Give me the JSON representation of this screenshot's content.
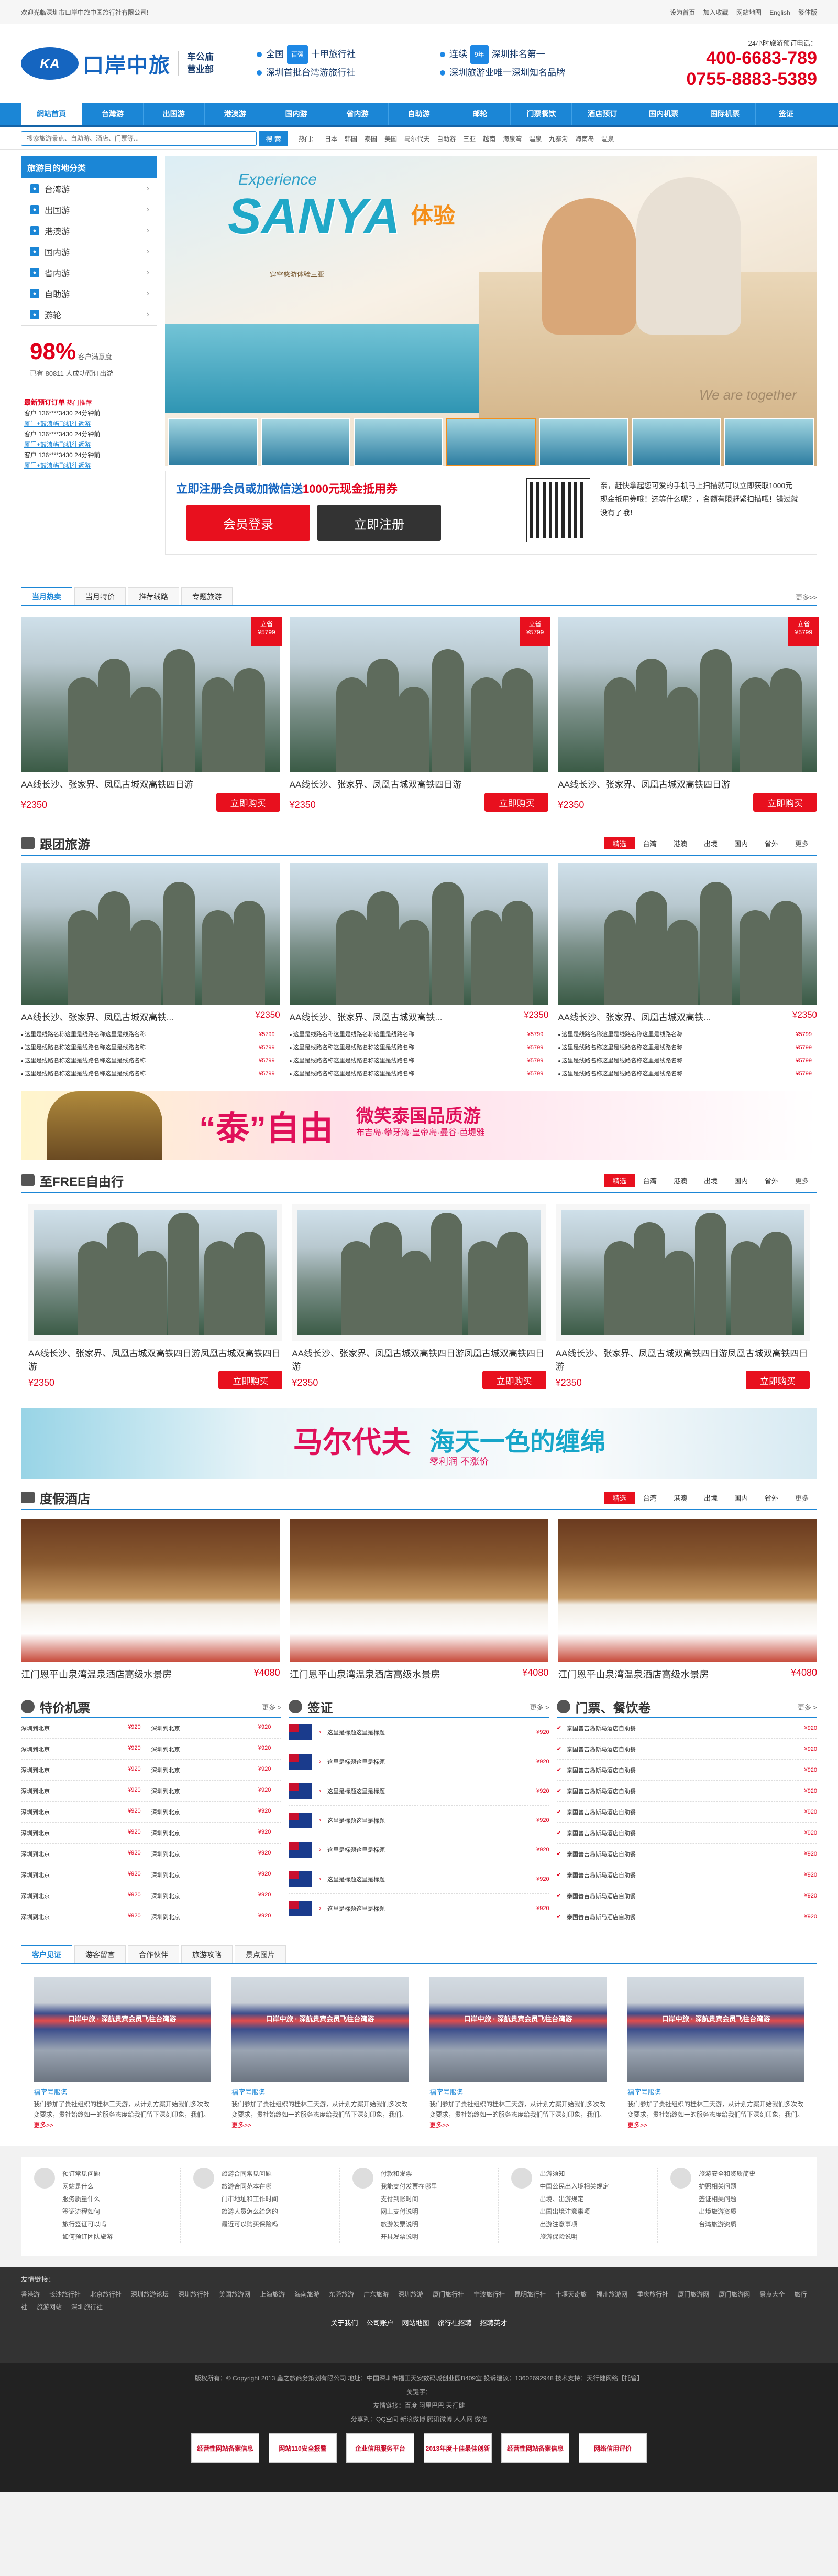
{
  "topbar": {
    "welcome": "欢迎光临深圳市口岸中旅中国旅行社有限公司!",
    "links": [
      "设为首页",
      "加入收藏",
      "网站地图",
      "English",
      "繁体版"
    ]
  },
  "header": {
    "logo_text": "口岸中旅",
    "logo_mark": "KA",
    "branch": [
      "车公庙",
      "营业部"
    ],
    "badges": [
      {
        "a": "全国",
        "tag": "百强",
        "b": "十甲旅行社"
      },
      {
        "a": "连续",
        "tag": "9年",
        "b": "深圳排名第一"
      },
      {
        "a": "深圳首批台湾游旅行社",
        "tag": "",
        "b": ""
      },
      {
        "a": "深圳旅游业唯一深圳知名品牌",
        "tag": "",
        "b": ""
      }
    ],
    "hotline_label": "24小时旅游预订电话：",
    "phone1": "400-6683-789",
    "phone2": "0755-8883-5389"
  },
  "nav": [
    "網站首頁",
    "台灣游",
    "出国游",
    "港澳游",
    "国内游",
    "省内游",
    "自助游",
    "邮轮",
    "门票餐饮",
    "酒店预订",
    "国内机票",
    "国际机票",
    "签证"
  ],
  "search": {
    "placeholder": "搜索旅游景点、自助游、酒店、门票等...",
    "button": "搜 索",
    "hot_label": "热门：",
    "hot": [
      "日本",
      "韩国",
      "泰国",
      "美国",
      "马尔代夫",
      "自助游",
      "三亚",
      "越南",
      "海泉湾",
      "温泉",
      "九寨沟",
      "海南岛",
      "温泉"
    ]
  },
  "sidebar": {
    "title": "旅游目的地分类",
    "items": [
      {
        "label": "台湾游",
        "icon": "taiwan-icon"
      },
      {
        "label": "出国游",
        "icon": "globe-icon"
      },
      {
        "label": "港澳游",
        "icon": "city-icon"
      },
      {
        "label": "国内游",
        "icon": "map-icon"
      },
      {
        "label": "省内游",
        "icon": "flag-icon"
      },
      {
        "label": "自助游",
        "icon": "backpack-icon"
      },
      {
        "label": "游轮",
        "icon": "ship-icon"
      }
    ],
    "satisfaction": "98%",
    "satisfaction_label": "客户满意度",
    "sat_text": "已有 80811 人成功预订出游",
    "orders_title": "最新预订订单",
    "orders_sub": "热门推荐",
    "orders": [
      {
        "a": "客户 136****3430 24分钟前",
        "b": "厦门+鼓浪屿飞机往返游"
      },
      {
        "a": "客户 136****3430 24分钟前",
        "b": "厦门+鼓浪屿飞机往返游"
      },
      {
        "a": "客户 136****3430 24分钟前",
        "b": "厦门+鼓浪屿飞机往返游"
      }
    ]
  },
  "banner": {
    "experience": "Experience",
    "sanya": "SANYA",
    "cn": "体验",
    "sub": "穿空悠游体验三亚",
    "tagline": "We are together"
  },
  "register": {
    "text1": "立即注册会员或加微信送",
    "text2": "1000元现金抵用券",
    "login": "会员登录",
    "signup": "立即注册",
    "qr_text": "亲，赶快拿起您可爱的手机马上扫描就可以立即获取1000元现金抵用券哦！还等什么呢？，名额有限赶紧扫描哦！错过就没有了哦！"
  },
  "hot": {
    "tabs": [
      "当月热卖",
      "当月特价",
      "推荐线路",
      "专题旅游"
    ],
    "more": "更多>>",
    "cards": [
      {
        "title": "AA线长沙、张家界、凤凰古城双高铁四日游",
        "price": "¥2350",
        "buy": "立即购买",
        "rib1": "立省",
        "rib2": "¥5799"
      },
      {
        "title": "AA线长沙、张家界、凤凰古城双高铁四日游",
        "price": "¥2350",
        "buy": "立即购买",
        "rib1": "立省",
        "rib2": "¥5799"
      },
      {
        "title": "AA线长沙、张家界、凤凰古城双高铁四日游",
        "price": "¥2350",
        "buy": "立即购买",
        "rib1": "立省",
        "rib2": "¥5799"
      }
    ]
  },
  "group": {
    "title": "跟团旅游",
    "filters": [
      "精选",
      "台湾",
      "港澳",
      "出境",
      "国内",
      "省外",
      "更多"
    ],
    "cards": [
      {
        "title": "AA线长沙、张家界、凤凰古城双高铁...",
        "price": "¥2350"
      },
      {
        "title": "AA线长沙、张家界、凤凰古城双高铁...",
        "price": "¥2350"
      },
      {
        "title": "AA线长沙、张家界、凤凰古城双高铁...",
        "price": "¥2350"
      }
    ],
    "line": "这里是线路名称这里是线路名称这里是线路名称",
    "line_price": "¥5799"
  },
  "ad1": {
    "t1": "“泰”自由",
    "t2": "微笑泰国品质游",
    "t3": "布吉岛·攀牙湾·皇帝岛·曼谷·芭堤雅"
  },
  "free": {
    "title": "至FREE自由行",
    "filters": [
      "精选",
      "台湾",
      "港澳",
      "出境",
      "国内",
      "省外",
      "更多"
    ],
    "cards": [
      {
        "title": "AA线长沙、张家界、凤凰古城双高铁四日游凤凰古城双高铁四日游",
        "price": "¥2350",
        "buy": "立即购买"
      },
      {
        "title": "AA线长沙、张家界、凤凰古城双高铁四日游凤凰古城双高铁四日游",
        "price": "¥2350",
        "buy": "立即购买"
      },
      {
        "title": "AA线长沙、张家界、凤凰古城双高铁四日游凤凰古城双高铁四日游",
        "price": "¥2350",
        "buy": "立即购买"
      }
    ]
  },
  "ad2": {
    "t1": "马尔代夫",
    "t2": "海天一色的缠绵",
    "t3": "零利润 不涨价"
  },
  "hotel": {
    "title": "度假酒店",
    "filters": [
      "精选",
      "台湾",
      "港澳",
      "出境",
      "国内",
      "省外",
      "更多"
    ],
    "cards": [
      {
        "title": "江门恩平山泉湾温泉酒店高级水景房",
        "price": "¥4080"
      },
      {
        "title": "江门恩平山泉湾温泉酒店高级水景房",
        "price": "¥4080"
      },
      {
        "title": "江门恩平山泉湾温泉酒店高级水景房",
        "price": "¥4080"
      }
    ]
  },
  "flights": {
    "title": "特价机票",
    "more": "更多 >",
    "route": "深圳到北京",
    "price": "¥920"
  },
  "visa": {
    "title": "签证",
    "more": "更多 >",
    "item": "这里是标题这里是标题",
    "price": "¥920"
  },
  "tickets": {
    "title": "门票、餐饮卷",
    "more": "更多 >",
    "item": "泰国普吉岛斯马酒店自助餐",
    "price": "¥920"
  },
  "reviews": {
    "tabs": [
      "客户见证",
      "游客留言",
      "合作伙伴",
      "旅游攻略",
      "景点图片"
    ],
    "cards": [
      {
        "cat": "福字号服务",
        "desc": "我们参加了贵社组织的桂林三天游，从计划方案开始我们多次改变要求，贵社始终如一的服务态度给我们留下深刻印象，我们。",
        "more": "更多>>"
      },
      {
        "cat": "福字号服务",
        "desc": "我们参加了贵社组织的桂林三天游，从计划方案开始我们多次改变要求，贵社始终如一的服务态度给我们留下深刻印象，我们。",
        "more": "更多>>"
      },
      {
        "cat": "福字号服务",
        "desc": "我们参加了贵社组织的桂林三天游，从计划方案开始我们多次改变要求，贵社始终如一的服务态度给我们留下深刻印象，我们。",
        "more": "更多>>"
      },
      {
        "cat": "福字号服务",
        "desc": "我们参加了贵社组织的桂林三天游，从计划方案开始我们多次改变要求，贵社始终如一的服务态度给我们留下深刻印象，我们。",
        "more": "更多>>"
      }
    ],
    "banner_text": "口岸中旅 · 深航贵宾会员飞往台湾游"
  },
  "help": [
    {
      "lines": [
        "预订常见问题",
        "网站是什么",
        "服务质量什么",
        "签证流程如何",
        "旅行签证可以吗",
        "如何预订团队旅游"
      ]
    },
    {
      "lines": [
        "旅游合同常见问题",
        "旅游合同范本在哪",
        "门市地址和工作时间",
        "旅游人员怎么给您的",
        "最近可以购买保险吗"
      ]
    },
    {
      "lines": [
        "付款和发票",
        "我能支付发票在哪里",
        "支付到账时间",
        "网上支付说明",
        "旅游发票说明",
        "开具发票说明"
      ]
    },
    {
      "lines": [
        "出游须知",
        "中国公民出入境相关规定",
        "出境、出游规定",
        "出国出境注意事项",
        "出游注意事项",
        "旅游保险说明"
      ]
    },
    {
      "lines": [
        "旅游安全和资质简史",
        "护照相关问题",
        "签证相关问题",
        "出境旅游资质",
        "台湾旅游资质"
      ]
    }
  ],
  "footer": {
    "links_title": "友情链接：",
    "links": [
      "香港游",
      "长沙旅行社",
      "北京旅行社",
      "深圳旅游论坛",
      "深圳旅行社",
      "美国旅游网",
      "上海旅游",
      "海南旅游",
      "东莞旅游",
      "广东旅游",
      "深圳旅游",
      "厦门旅行社",
      "宁波旅行社",
      "昆明旅行社",
      "十堰天奇旅",
      "福州旅游网",
      "重庆旅行社",
      "厦门旅游网",
      "厦门旅游网",
      "景点大全",
      "旅行社",
      "旅游网站",
      "深圳旅行社"
    ],
    "nav": [
      "关于我们",
      "公司账户",
      "网站地图",
      "旅行社招聘",
      "招聘英才"
    ],
    "copyright": "版权所有：© Copyright 2013  鑫之旅商务策划有限公司  地址：中国深圳市福田天安数码城创业园B409室  投诉建议：13602692948  技术支持：天行健网络【托管】",
    "friends": "友情链接：百度 阿里巴巴 天行健",
    "about": "关键字：",
    "share": "分享到：QQ空间 新浪微博 腾讯微博 人人网 微信",
    "trust": [
      "经营性网站备案信息",
      "网站110安全报警",
      "企业信用服务平台",
      "2013年度十佳最佳创新",
      "经营性网站备案信息",
      "网络信用评价"
    ]
  }
}
